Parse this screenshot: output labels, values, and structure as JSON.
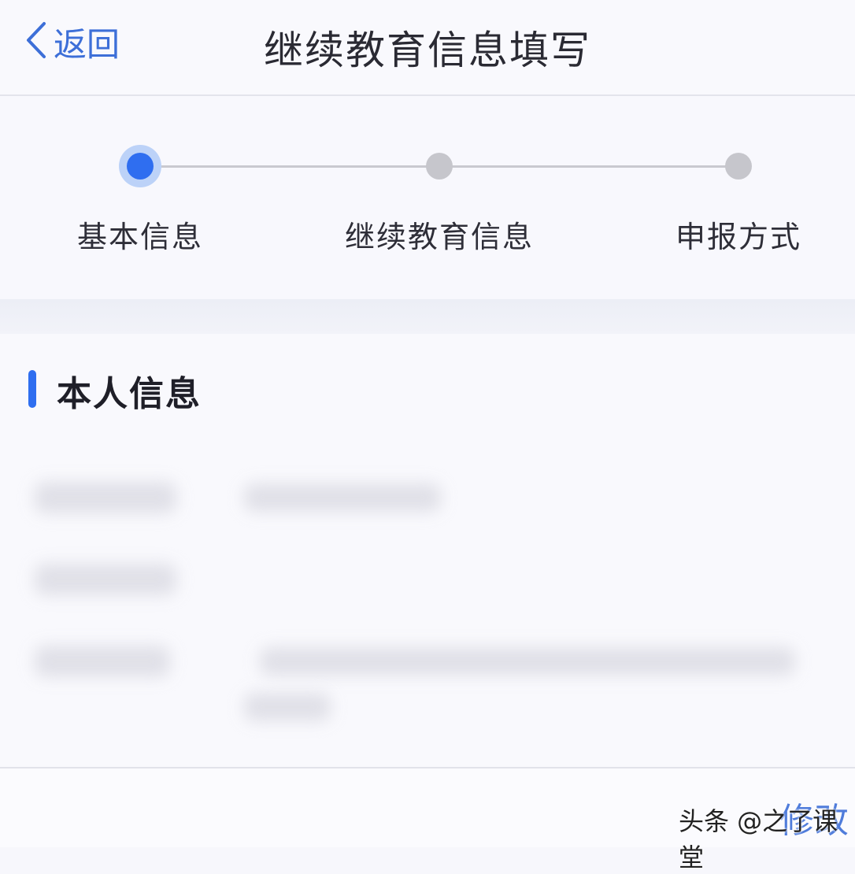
{
  "header": {
    "back_label": "返回",
    "title": "继续教育信息填写"
  },
  "steps": [
    {
      "label": "基本信息",
      "active": true
    },
    {
      "label": "继续教育信息",
      "active": false
    },
    {
      "label": "申报方式",
      "active": false
    }
  ],
  "section": {
    "title": "本人信息"
  },
  "footer": {
    "edit_label": "修改"
  },
  "watermark": "头条 @之了课堂",
  "colors": {
    "accent": "#2f6ef0",
    "inactive_dot": "#c6c6cc"
  }
}
